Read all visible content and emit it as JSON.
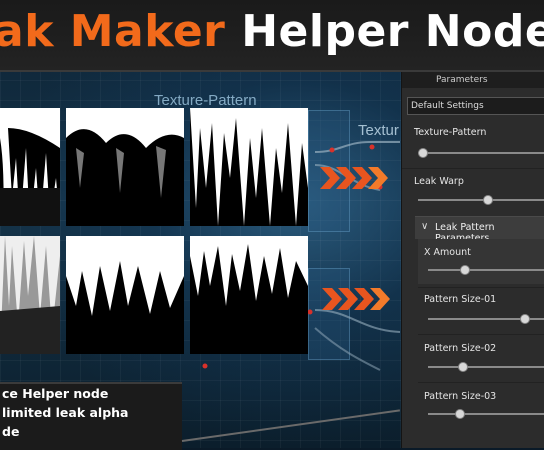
{
  "banner": {
    "title_orange": "ak Maker",
    "title_white": "Helper Node"
  },
  "graph": {
    "label_texture_pattern": "Texture-Pattern",
    "label_texture_2": "Textur"
  },
  "caption": {
    "line1": "ce Helper node",
    "line2": "limited leak alpha",
    "line3": "de"
  },
  "panel": {
    "header": "Parameters",
    "preset": "Default Settings",
    "texture_pattern_label": "Texture-Pattern",
    "texture_pattern_value": 0.0,
    "leak_warp_label": "Leak Warp",
    "leak_warp_value": 0.55,
    "section_label": "Leak Pattern Parameters",
    "x_amount_label": "X Amount",
    "x_amount_value": 0.3,
    "pattern_size_01_label": "Pattern Size-01",
    "pattern_size_01_value": 0.85,
    "pattern_size_02_label": "Pattern Size-02",
    "pattern_size_02_value": 0.28,
    "pattern_size_03_label": "Pattern Size-03",
    "pattern_size_03_value": 0.25
  },
  "colors": {
    "accent_orange": "#f26a1b",
    "arrow_red": "#e03a1a"
  },
  "icons": {
    "section_chevron": "chevron-down-icon",
    "flow_arrows": "arrow-right-icon"
  }
}
